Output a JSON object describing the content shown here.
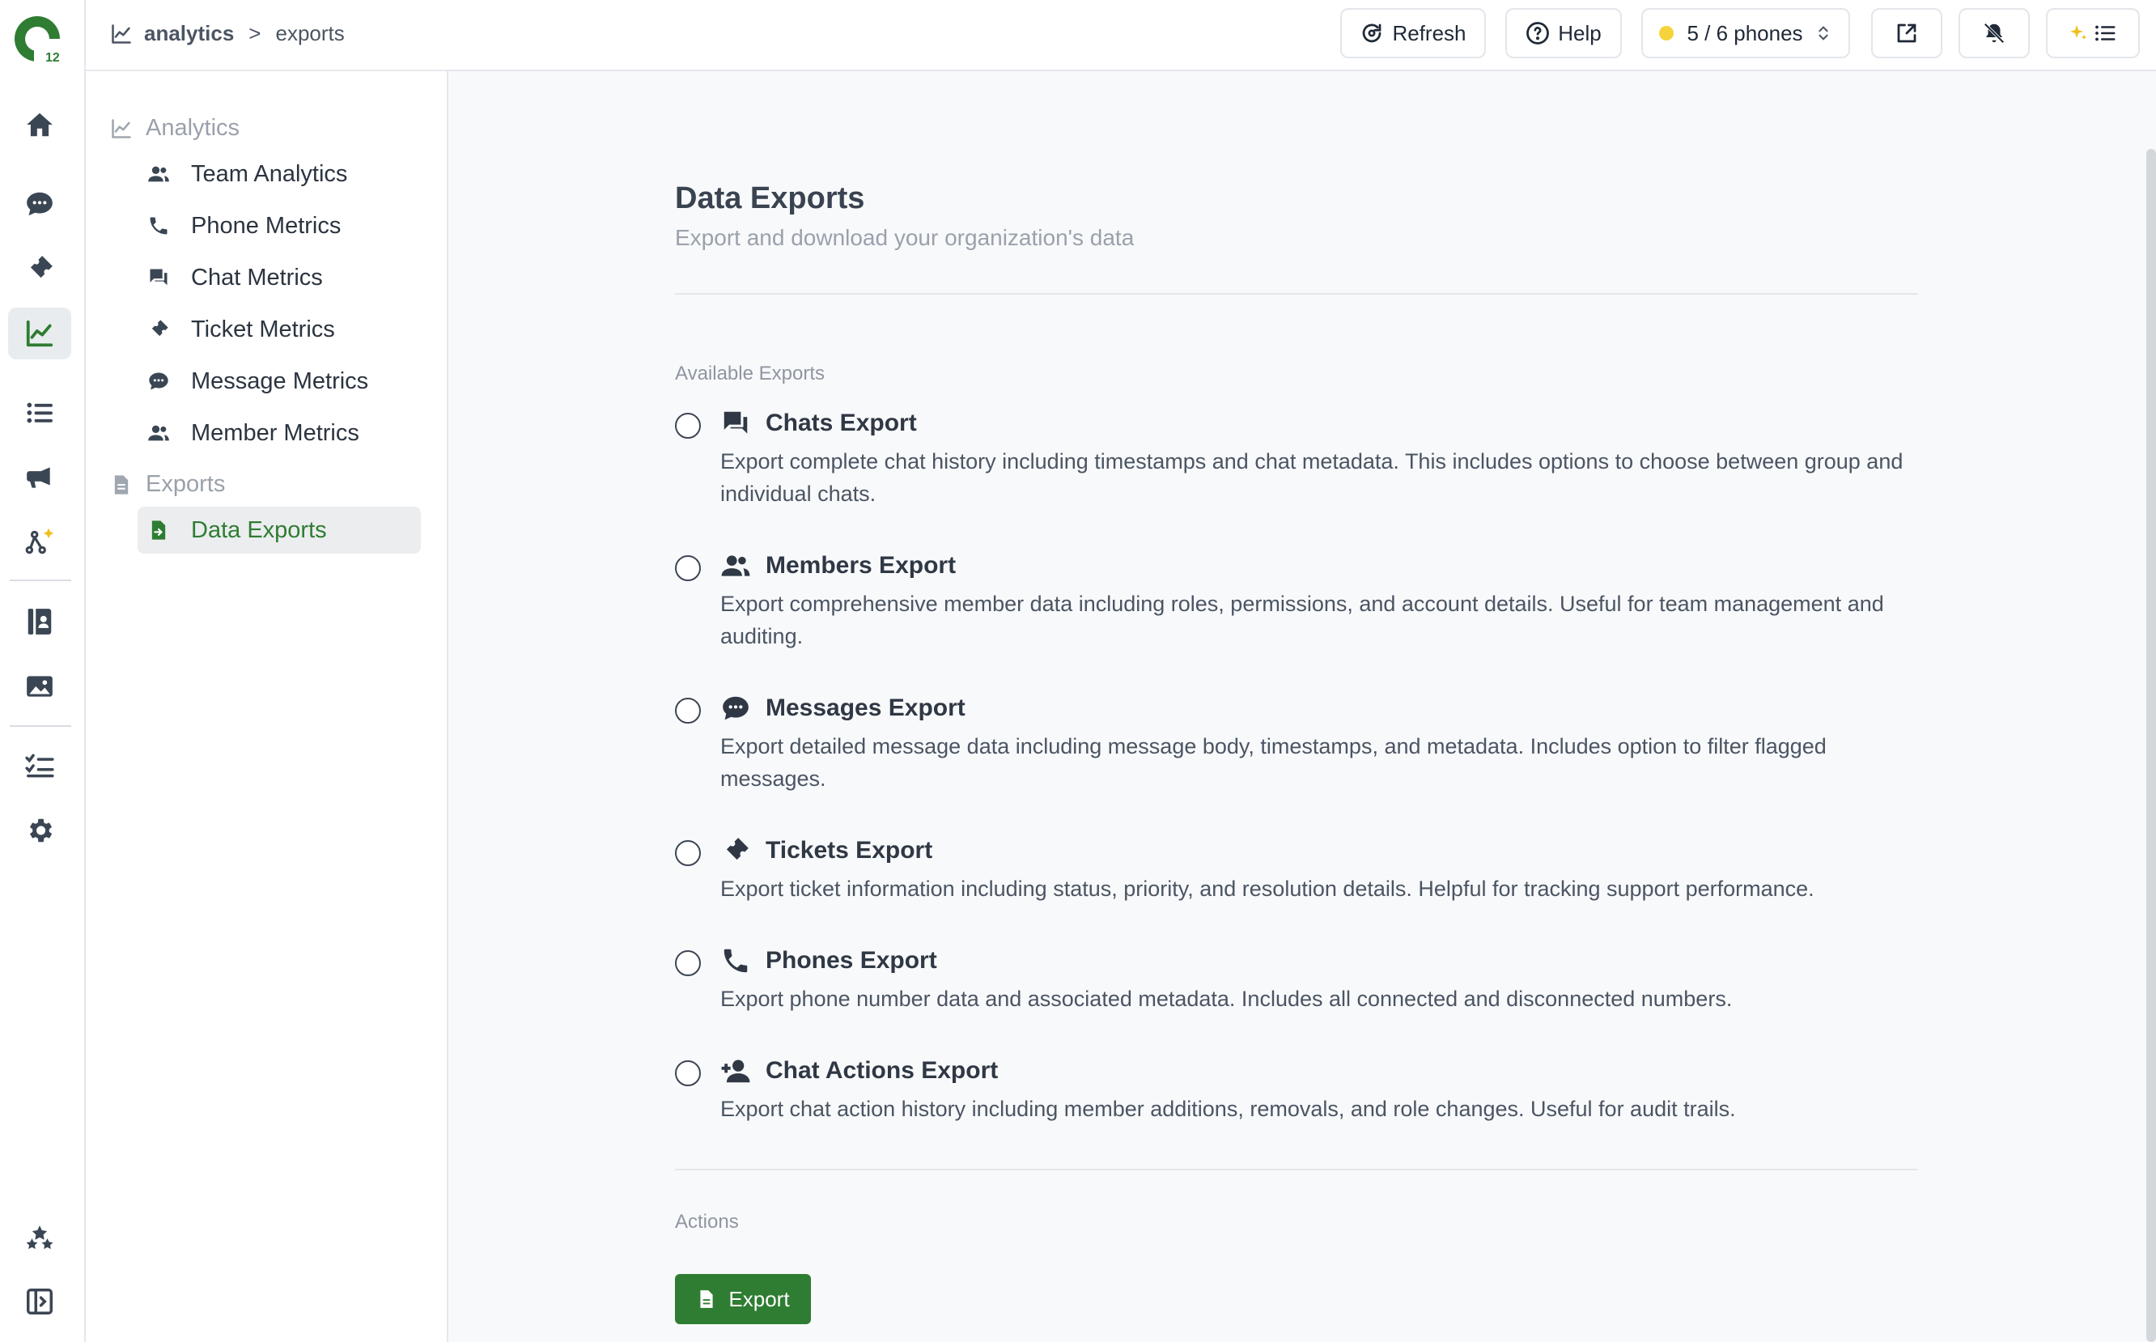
{
  "app": {
    "logo": {
      "text": "12",
      "icon": "logo-icon",
      "color": "#2e7d32"
    }
  },
  "rail": {
    "items": [
      {
        "name": "home",
        "icon": "home-icon"
      },
      {
        "name": "chats",
        "icon": "chat-bubble-icon"
      },
      {
        "name": "tickets",
        "icon": "ticket-icon"
      },
      {
        "name": "analytics",
        "icon": "chart-line-icon",
        "active": true
      },
      {
        "name": "lists",
        "icon": "list-icon"
      },
      {
        "name": "broadcast",
        "icon": "megaphone-icon"
      },
      {
        "name": "automation",
        "icon": "workflow-sparkle-icon"
      },
      {
        "name": "contacts",
        "icon": "address-book-icon"
      },
      {
        "name": "media",
        "icon": "image-icon"
      },
      {
        "name": "tasks",
        "icon": "checklist-icon"
      },
      {
        "name": "settings",
        "icon": "gear-icon"
      },
      {
        "name": "extras",
        "icon": "stars-icon"
      },
      {
        "name": "collapse",
        "icon": "sidebar-toggle-icon"
      }
    ]
  },
  "breadcrumb": {
    "root": "analytics",
    "separator": ">",
    "current": "exports"
  },
  "toolbar": {
    "refresh_label": "Refresh",
    "help_label": "Help",
    "phones_label": "5 / 6 phones",
    "phones_status_color": "#f5d33b"
  },
  "sidebar": {
    "analytics_header": "Analytics",
    "analytics_items": [
      {
        "label": "Team Analytics",
        "icon": "users-icon"
      },
      {
        "label": "Phone Metrics",
        "icon": "phone-icon"
      },
      {
        "label": "Chat Metrics",
        "icon": "chat-icon"
      },
      {
        "label": "Ticket Metrics",
        "icon": "ticket-icon"
      },
      {
        "label": "Message Metrics",
        "icon": "message-icon"
      },
      {
        "label": "Member Metrics",
        "icon": "users-icon"
      }
    ],
    "exports_header": "Exports",
    "exports_items": [
      {
        "label": "Data Exports",
        "icon": "file-export-icon",
        "active": true
      }
    ]
  },
  "main": {
    "title": "Data Exports",
    "subtitle": "Export and download your organization's data",
    "available_label": "Available Exports",
    "options": [
      {
        "title": "Chats Export",
        "icon": "chats-icon",
        "desc": "Export complete chat history including timestamps and chat metadata. This includes options to choose between group and individual chats."
      },
      {
        "title": "Members Export",
        "icon": "users-icon",
        "desc": "Export comprehensive member data including roles, permissions, and account details. Useful for team management and auditing."
      },
      {
        "title": "Messages Export",
        "icon": "message-icon",
        "desc": "Export detailed message data including message body, timestamps, and metadata. Includes option to filter flagged messages."
      },
      {
        "title": "Tickets Export",
        "icon": "ticket-icon",
        "desc": "Export ticket information including status, priority, and resolution details. Helpful for tracking support performance."
      },
      {
        "title": "Phones Export",
        "icon": "phone-icon",
        "desc": "Export phone number data and associated metadata. Includes all connected and disconnected numbers."
      },
      {
        "title": "Chat Actions Export",
        "icon": "user-plus-icon",
        "desc": "Export chat action history including member additions, removals, and role changes. Useful for audit trails."
      }
    ],
    "actions_label": "Actions",
    "export_button": "Export",
    "accent_color": "#2e7d32"
  }
}
